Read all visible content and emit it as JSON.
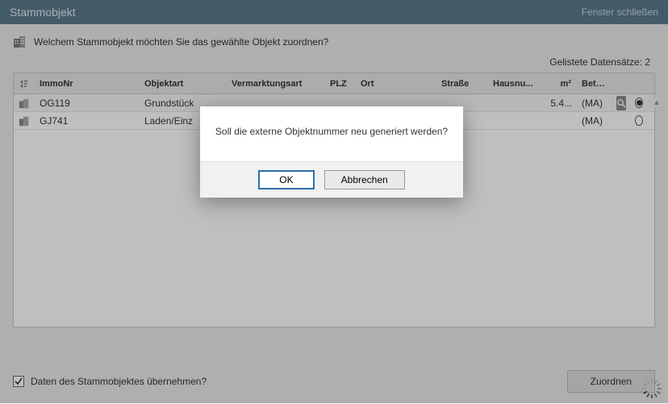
{
  "titlebar": {
    "title": "Stammobjekt",
    "close": "Fenster schließen"
  },
  "prompt": "Welchem Stammobjekt möchten Sie das gewählte Objekt zuordnen?",
  "count_label": "Gelistete Datensätze:",
  "count_value": "2",
  "columns": {
    "immonr": "ImmoNr",
    "objektart": "Objektart",
    "vermarkt": "Vermarktungsart",
    "plz": "PLZ",
    "ort": "Ort",
    "strasse": "Straße",
    "hausnu": "Hausnu...",
    "m2": "m²",
    "betreuer": "Betreuer"
  },
  "rows": [
    {
      "immonr": "OG119",
      "objektart": "Grundstück",
      "m2": "5.4...",
      "betreuer": "(MA)",
      "selected": true,
      "has_search": true
    },
    {
      "immonr": "GJ741",
      "objektart": "Laden/Einz",
      "m2": "",
      "betreuer": "(MA)",
      "selected": false,
      "has_search": false
    }
  ],
  "footer": {
    "checkbox_label": "Daten des Stammobjektes übernehmen?",
    "assign": "Zuordnen"
  },
  "modal": {
    "message": "Soll die externe Objektnummer neu generiert werden?",
    "ok": "OK",
    "cancel": "Abbrechen"
  }
}
